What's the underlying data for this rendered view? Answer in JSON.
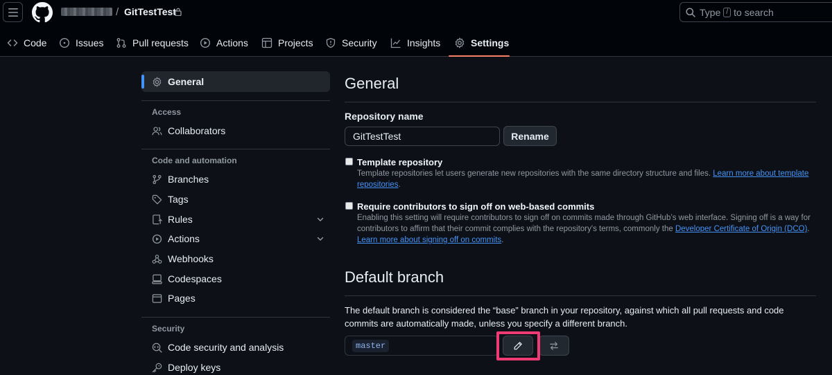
{
  "header": {
    "repo_separator": "/",
    "repo_name": "GitTestTest",
    "search": {
      "prefix": "Type",
      "key": "/",
      "suffix": "to search"
    }
  },
  "nav": {
    "tabs": [
      {
        "label": "Code",
        "icon": "code-icon"
      },
      {
        "label": "Issues",
        "icon": "issue-icon"
      },
      {
        "label": "Pull requests",
        "icon": "pull-request-icon"
      },
      {
        "label": "Actions",
        "icon": "play-icon"
      },
      {
        "label": "Projects",
        "icon": "table-icon"
      },
      {
        "label": "Security",
        "icon": "shield-icon"
      },
      {
        "label": "Insights",
        "icon": "graph-icon"
      },
      {
        "label": "Settings",
        "icon": "gear-icon",
        "active": true
      }
    ]
  },
  "sidebar": {
    "general": "General",
    "sections": {
      "access": "Access",
      "code_automation": "Code and automation",
      "security": "Security"
    },
    "items": {
      "collaborators": "Collaborators",
      "branches": "Branches",
      "tags": "Tags",
      "rules": "Rules",
      "actions": "Actions",
      "webhooks": "Webhooks",
      "codespaces": "Codespaces",
      "pages": "Pages",
      "code_security": "Code security and analysis",
      "deploy_keys": "Deploy keys"
    }
  },
  "main": {
    "title": "General",
    "repo_name_label": "Repository name",
    "repo_name_value": "GitTestTest",
    "rename_button": "Rename",
    "template": {
      "title": "Template repository",
      "desc": "Template repositories let users generate new repositories with the same directory structure and files.",
      "link": "Learn more about template repositories",
      "after": "."
    },
    "signoff": {
      "title": "Require contributors to sign off on web-based commits",
      "desc": "Enabling this setting will require contributors to sign off on commits made through GitHub’s web interface. Signing off is a way for contributors to affirm that their commit complies with the repository's terms, commonly the",
      "dco_link": "Developer Certificate of Origin (DCO)",
      "mid": ".",
      "learn_link": "Learn more about signing off on commits",
      "after": "."
    },
    "default_branch": {
      "title": "Default branch",
      "desc": "The default branch is considered the “base” branch in your repository, against which all pull requests and code commits are automatically made, unless you specify a different branch.",
      "branch": "master"
    }
  },
  "colors": {
    "background": "#0d1117",
    "header_bg": "#010409",
    "accent_underline": "#f78166",
    "link": "#4493f8",
    "highlight": "#ee3b73"
  }
}
